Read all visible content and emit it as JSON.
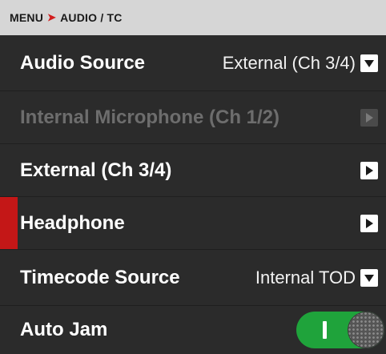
{
  "breadcrumb": {
    "root": "MENU",
    "separator": "➤",
    "current": "AUDIO / TC"
  },
  "rows": [
    {
      "label": "Audio Source",
      "value": "External (Ch 3/4)",
      "control": "dropdown",
      "enabled": true
    },
    {
      "label": "Internal Microphone (Ch 1/2)",
      "control": "submenu-arrow",
      "enabled": false
    },
    {
      "label": "External (Ch 3/4)",
      "control": "submenu-arrow",
      "enabled": true
    },
    {
      "label": "Headphone",
      "control": "submenu-arrow",
      "enabled": true,
      "selected": true
    },
    {
      "label": "Timecode Source",
      "value": "Internal TOD",
      "control": "dropdown",
      "enabled": true
    },
    {
      "label": "Auto Jam",
      "control": "toggle",
      "state": "on",
      "enabled": true
    }
  ],
  "colors": {
    "background": "#2a2a2a",
    "breadcrumb_bg": "#d6d6d6",
    "accent_red": "#c41717",
    "toggle_on": "#1fa33b",
    "disabled_text": "#6d6d6d"
  },
  "icons": {
    "dropdown": "chevron-down-icon",
    "submenu": "chevron-right-icon"
  }
}
